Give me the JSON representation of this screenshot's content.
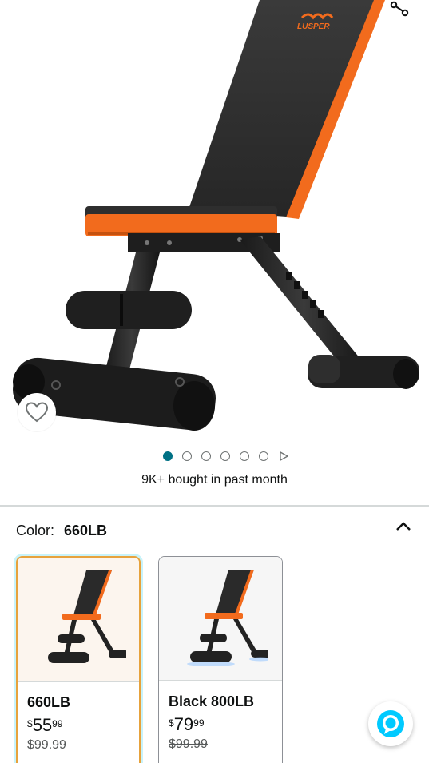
{
  "product": {
    "brand_logo_text": "LUSPER",
    "bought_text": "9K+ bought in past month"
  },
  "carousel": {
    "image_count": 6,
    "active_index": 0
  },
  "icons": {
    "share": "share-icon",
    "wishlist": "heart-outline-icon",
    "collapse": "chevron-up-icon",
    "play": "play-triangle-icon",
    "assistant": "alexa-ring-icon"
  },
  "variation": {
    "label": "Color:",
    "selected_value": "660LB",
    "options": [
      {
        "name": "660LB",
        "price_symbol": "$",
        "price_whole": "55",
        "price_fraction": "99",
        "list_price": "$99.99",
        "selected": true
      },
      {
        "name": "Black 800LB",
        "price_symbol": "$",
        "price_whole": "79",
        "price_fraction": "99",
        "list_price": "$99.99",
        "selected": false
      }
    ]
  },
  "colors": {
    "accent_teal": "#007185",
    "bench_orange": "#f26b1d",
    "selected_border": "#e7a23c",
    "alexa_blue": "#00caff"
  }
}
